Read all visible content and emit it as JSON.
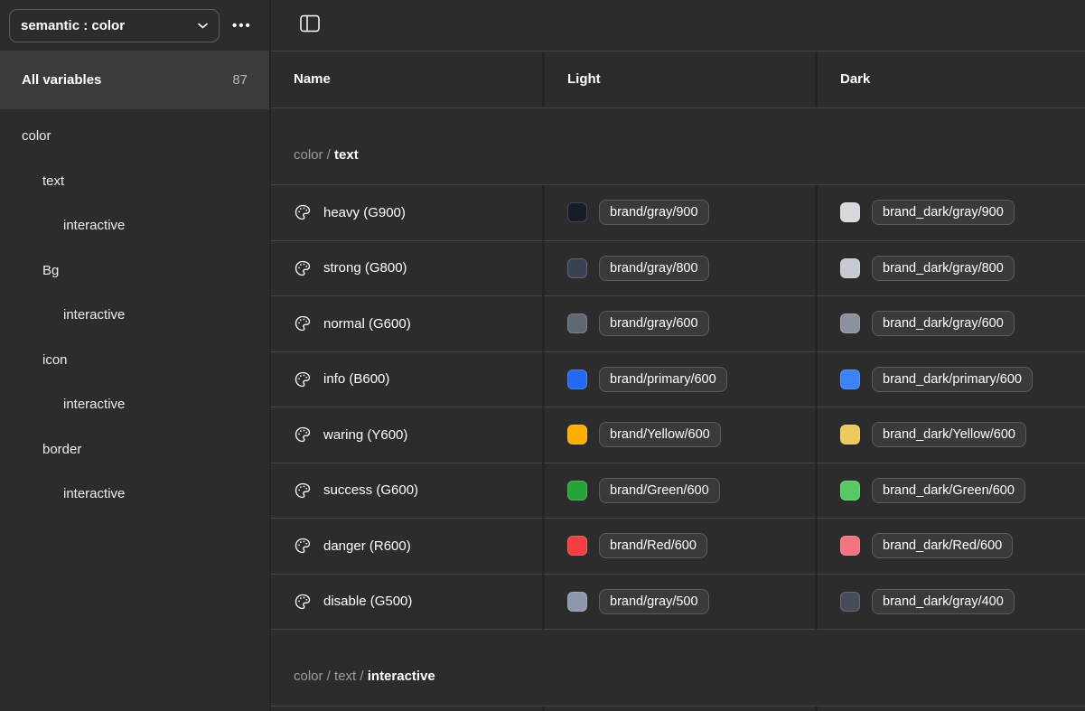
{
  "toolbar": {
    "collection": "semantic : color",
    "more": "•••"
  },
  "sidebar": {
    "all_variables_label": "All variables",
    "all_variables_count": "87",
    "tree": [
      {
        "label": "color",
        "level": 0
      },
      {
        "label": "text",
        "level": 1
      },
      {
        "label": "interactive",
        "level": 2
      },
      {
        "label": "Bg",
        "level": 1
      },
      {
        "label": "interactive",
        "level": 2
      },
      {
        "label": "icon",
        "level": 1
      },
      {
        "label": "interactive",
        "level": 2
      },
      {
        "label": "border",
        "level": 1
      },
      {
        "label": "interactive",
        "level": 2
      }
    ]
  },
  "table": {
    "columns": [
      "Name",
      "Light",
      "Dark"
    ],
    "sections": [
      {
        "breadcrumb": [
          {
            "text": "color",
            "strong": false
          },
          {
            "text": "text",
            "strong": true
          }
        ],
        "rows": [
          {
            "name": "heavy (G900)",
            "light_swatch": "#171c27",
            "light_chip": "brand/gray/900",
            "dark_swatch": "#d8d9dd",
            "dark_chip": "brand_dark/gray/900"
          },
          {
            "name": "strong (G800)",
            "light_swatch": "#3a4153",
            "light_chip": "brand/gray/800",
            "dark_swatch": "#c7cad3",
            "dark_chip": "brand_dark/gray/800"
          },
          {
            "name": "normal (G600)",
            "light_swatch": "#606876",
            "light_chip": "brand/gray/600",
            "dark_swatch": "#8b919e",
            "dark_chip": "brand_dark/gray/600"
          },
          {
            "name": "info (B600)",
            "light_swatch": "#2569f2",
            "light_chip": "brand/primary/600",
            "dark_swatch": "#3b82f6",
            "dark_chip": "brand_dark/primary/600"
          },
          {
            "name": "waring (Y600)",
            "light_swatch": "#fcae02",
            "light_chip": "brand/Yellow/600",
            "dark_swatch": "#eec95b",
            "dark_chip": "brand_dark/Yellow/600"
          },
          {
            "name": "success (G600)",
            "light_swatch": "#27a437",
            "light_chip": "brand/Green/600",
            "dark_swatch": "#57c865",
            "dark_chip": "brand_dark/Green/600"
          },
          {
            "name": "danger (R600)",
            "light_swatch": "#f53d42",
            "light_chip": "brand/Red/600",
            "dark_swatch": "#f2747c",
            "dark_chip": "brand_dark/Red/600"
          },
          {
            "name": "disable (G500)",
            "light_swatch": "#8e98aa",
            "light_chip": "brand/gray/500",
            "dark_swatch": "#454b58",
            "dark_chip": "brand_dark/gray/400"
          }
        ]
      },
      {
        "breadcrumb": [
          {
            "text": "color",
            "strong": false
          },
          {
            "text": "text",
            "strong": false
          },
          {
            "text": "interactive",
            "strong": true
          }
        ],
        "rows": []
      }
    ]
  }
}
